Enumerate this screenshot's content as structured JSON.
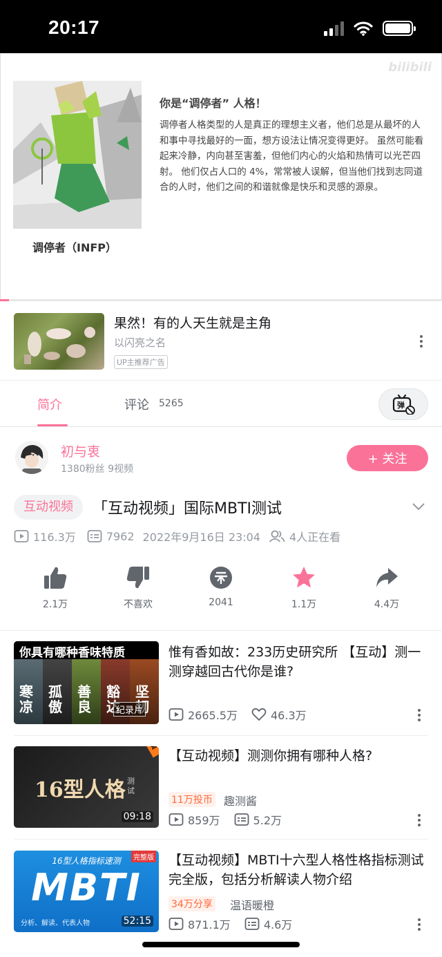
{
  "status_bar": {
    "time": "20:17"
  },
  "player": {
    "watermark": "bilibili",
    "persona_caption": "调停者（INFP）",
    "persona_title": "你是“调停者” 人格！",
    "persona_desc": "调停者人格类型的人是真正的理想主义者，他们总是从最坏的人和事中寻找最好的一面，想方设法让情况变得更好。 虽然可能看起来冷静，内向甚至害羞，但他们内心的火焰和热情可以光芒四射。 他们仅占人口的 4%，常常被人误解，但当他们找到志同道合的人时，他们之间的和谐就像是快乐和灵感的源泉。",
    "progress": 0.02
  },
  "ad": {
    "title": "果然！有的人天生就是主角",
    "subtitle": "以闪亮之名",
    "badge": "UP主推荐广告"
  },
  "tabs": {
    "intro": "简介",
    "comments": "评论",
    "comment_count": "5265"
  },
  "uploader": {
    "name": "初与衷",
    "stats": "1380粉丝  9视频",
    "follow": "+ 关注"
  },
  "video": {
    "tag": "互动视频",
    "title": "「互动视频」国际MBTI测试",
    "views": "116.3万",
    "danmaku": "7962",
    "date": "2022年9月16日 23:04",
    "watching": "4人正在看"
  },
  "actions": {
    "like": "2.1万",
    "dislike": "不喜欢",
    "coin": "2041",
    "favorite": "1.1万",
    "share": "4.4万"
  },
  "related": [
    {
      "title": "惟有香如故：233历史研究所 【互动】测一测穿越回古代你是谁?",
      "views": "2665.5万",
      "likes": "46.3万",
      "thumb_text": "你具有哪种香味特质",
      "thumb_words": [
        "寒凉",
        "孤傲",
        "善良",
        "豁达",
        "坚韧"
      ],
      "thumb_label": "纪录片"
    },
    {
      "title": "【互动视频】测测你拥有哪种人格?",
      "badge": "11万投币",
      "owner": "趣测酱",
      "views": "859万",
      "danmaku": "5.2万",
      "duration": "09:18",
      "thumb_text": "16型人格",
      "thumb_sub": "测试",
      "thumb_corner": "互动视频"
    },
    {
      "title": "【互动视频】MBTI十六型人格性格指标测试完全版，包括分析解读人物介绍",
      "badge": "34万分享",
      "owner": "温语暖橙",
      "views": "871.1万",
      "danmaku": "4.6万",
      "duration": "52:15",
      "thumb_top": "16型人格指标速测",
      "thumb_main": "MBTI",
      "thumb_bottom": "分析、解读、代表人物",
      "thumb_corner": "完整版"
    }
  ],
  "colors": {
    "accent": "#fb7299",
    "text": "#18191c",
    "muted": "#9499a0",
    "orange": "#ff6a3b"
  }
}
